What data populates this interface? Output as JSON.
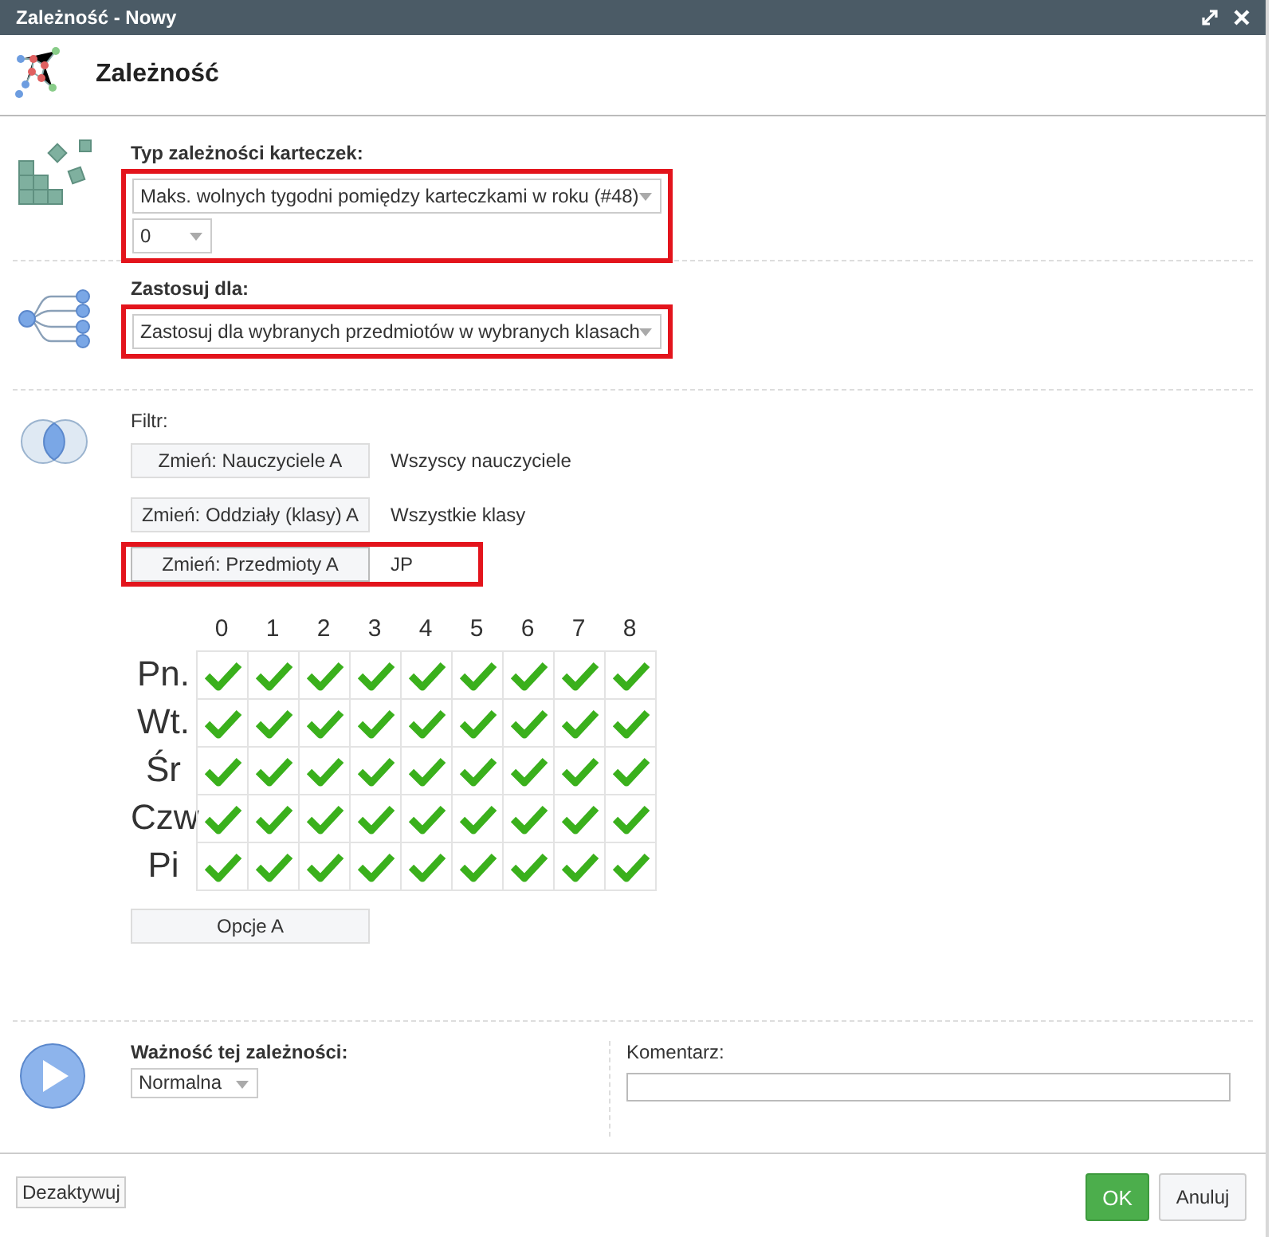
{
  "window": {
    "title": "Zależność - Nowy"
  },
  "header": {
    "title": "Zależność"
  },
  "type_section": {
    "label": "Typ zależności karteczek:",
    "highlighted": true,
    "type_select": "Maks. wolnych tygodni pomiędzy karteczkami w roku (#48)",
    "value_select": "0"
  },
  "apply_section": {
    "label": "Zastosuj dla:",
    "highlighted": true,
    "select": "Zastosuj dla wybranych przedmiotów w wybranych klasach"
  },
  "filter_section": {
    "label": "Filtr:",
    "filters": [
      {
        "button": "Zmień: Nauczyciele A",
        "value": "Wszyscy nauczyciele",
        "highlighted": false
      },
      {
        "button": "Zmień: Oddziały (klasy) A",
        "value": "Wszystkie klasy",
        "highlighted": false
      },
      {
        "button": "Zmień: Przedmioty A",
        "value": "JP",
        "highlighted": true
      }
    ],
    "grid": {
      "columns": [
        "0",
        "1",
        "2",
        "3",
        "4",
        "5",
        "6",
        "7",
        "8"
      ],
      "rows": [
        {
          "label": "Pn.",
          "checked": [
            true,
            true,
            true,
            true,
            true,
            true,
            true,
            true,
            true
          ]
        },
        {
          "label": "Wt.",
          "checked": [
            true,
            true,
            true,
            true,
            true,
            true,
            true,
            true,
            true
          ]
        },
        {
          "label": "Śr",
          "checked": [
            true,
            true,
            true,
            true,
            true,
            true,
            true,
            true,
            true
          ]
        },
        {
          "label": "Czw",
          "checked": [
            true,
            true,
            true,
            true,
            true,
            true,
            true,
            true,
            true
          ]
        },
        {
          "label": "Pi",
          "checked": [
            true,
            true,
            true,
            true,
            true,
            true,
            true,
            true,
            true
          ]
        }
      ]
    },
    "options_button": "Opcje A"
  },
  "importance": {
    "label": "Ważność tej zależności:",
    "select": "Normalna"
  },
  "comment": {
    "label": "Komentarz:"
  },
  "footer": {
    "deactivate": "Dezaktywuj",
    "ok": "OK",
    "cancel": "Anuluj"
  }
}
